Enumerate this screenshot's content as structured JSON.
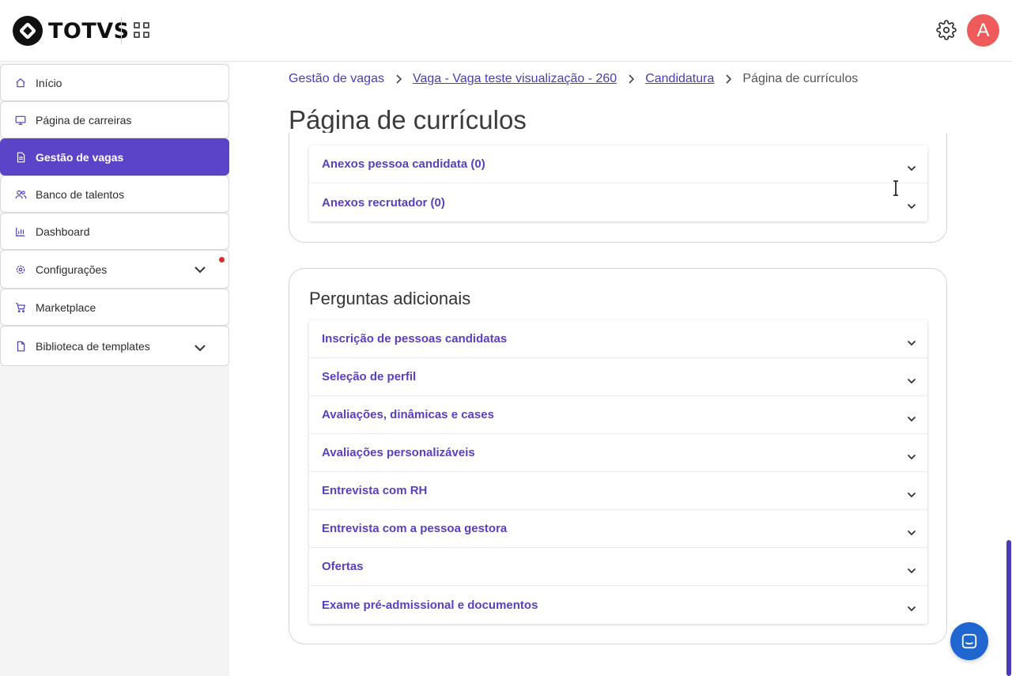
{
  "app": {
    "brand": "TOTVS",
    "avatar_letter": "A",
    "avatar_color": "#ef5b5b",
    "accent_color": "#5b44c7"
  },
  "sidebar": {
    "items": [
      {
        "label": "Início",
        "icon": "home-icon",
        "active": false
      },
      {
        "label": "Página de carreiras",
        "icon": "monitor-icon",
        "active": false
      },
      {
        "label": "Gestão de vagas",
        "icon": "document-icon",
        "active": true
      },
      {
        "label": "Banco de talentos",
        "icon": "users-icon",
        "active": false
      },
      {
        "label": "Dashboard",
        "icon": "bar-chart-icon",
        "active": false
      },
      {
        "label": "Configurações",
        "icon": "gear-icon",
        "active": false,
        "expandable": true,
        "notification": true
      },
      {
        "label": "Marketplace",
        "icon": "cart-icon",
        "active": false
      },
      {
        "label": "Biblioteca de templates",
        "icon": "file-icon",
        "active": false,
        "expandable": true
      }
    ]
  },
  "breadcrumb": {
    "items": [
      {
        "label": "Gestão de vagas"
      },
      {
        "label": "Vaga - Vaga teste visualização - 260"
      },
      {
        "label": "Candidatura"
      },
      {
        "label": "Página de currículos"
      }
    ]
  },
  "page": {
    "title": "Página de currículos"
  },
  "attachments": {
    "items": [
      {
        "label": "Anexos pessoa candidata (0)"
      },
      {
        "label": "Anexos recrutador (0)"
      }
    ]
  },
  "questions": {
    "title": "Perguntas adicionais",
    "items": [
      {
        "label": "Inscrição de pessoas candidatas"
      },
      {
        "label": "Seleção de perfil"
      },
      {
        "label": "Avaliações, dinâmicas e cases"
      },
      {
        "label": "Avaliações personalizáveis"
      },
      {
        "label": "Entrevista com RH"
      },
      {
        "label": "Entrevista com a pessoa gestora"
      },
      {
        "label": "Ofertas"
      },
      {
        "label": "Exame pré-admissional e documentos"
      }
    ]
  }
}
